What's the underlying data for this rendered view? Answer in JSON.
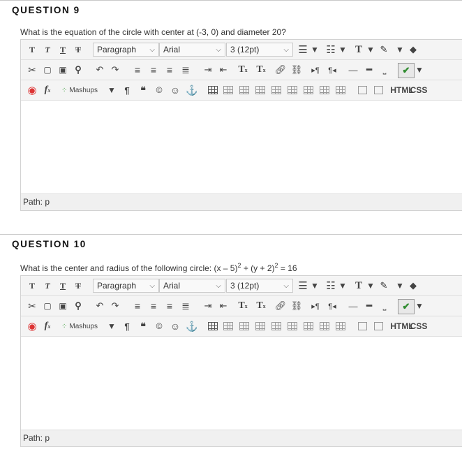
{
  "questions": [
    {
      "heading": "QUESTION 9",
      "prompt": "What is the equation of the circle with center at (-3, 0) and diameter 20?",
      "prompt_parts": null,
      "path_label": "Path: p"
    },
    {
      "heading": "QUESTION 10",
      "prompt": "",
      "prompt_parts": {
        "a": "What is the center and radius of the following circle: (x – 5)",
        "exp1": "2",
        "b": " + (y + 2)",
        "exp2": "2",
        "c": " = 16"
      },
      "path_label": "Path: p"
    }
  ],
  "toolbar": {
    "format_select": "Paragraph",
    "font_select": "Arial",
    "size_select": "3 (12pt)",
    "mashups_label": "Mashups",
    "html_label": "HTML",
    "css_label": "CSS",
    "superscript_label": "T",
    "subscript_label": "T",
    "tt_labels": [
      "T",
      "T",
      "T",
      "T"
    ]
  }
}
